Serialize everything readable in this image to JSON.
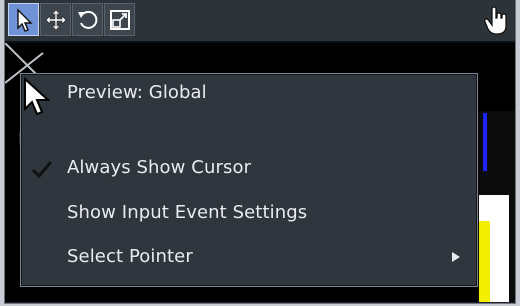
{
  "toolbar": {
    "tools": [
      {
        "name": "select",
        "icon": "arrow-cursor-icon",
        "active": true
      },
      {
        "name": "move",
        "icon": "move-cross-icon",
        "active": false
      },
      {
        "name": "rotate",
        "icon": "rotate-icon",
        "active": false
      },
      {
        "name": "scale",
        "icon": "scale-icon",
        "active": false
      }
    ],
    "right_tool_icon": "hand-pointer-icon"
  },
  "context_menu": {
    "items": [
      {
        "label": "Preview: Global",
        "checked": false,
        "submenu": false
      },
      {
        "label": "Always Show Cursor",
        "checked": true,
        "submenu": false
      },
      {
        "label": "Show Input Event Settings",
        "checked": false,
        "submenu": false
      },
      {
        "label": "Select Pointer",
        "checked": false,
        "submenu": true
      }
    ]
  },
  "colors": {
    "active_tool": "#6f93d6",
    "menu_bg": "#2f363d",
    "menu_text": "#e9ecef"
  }
}
